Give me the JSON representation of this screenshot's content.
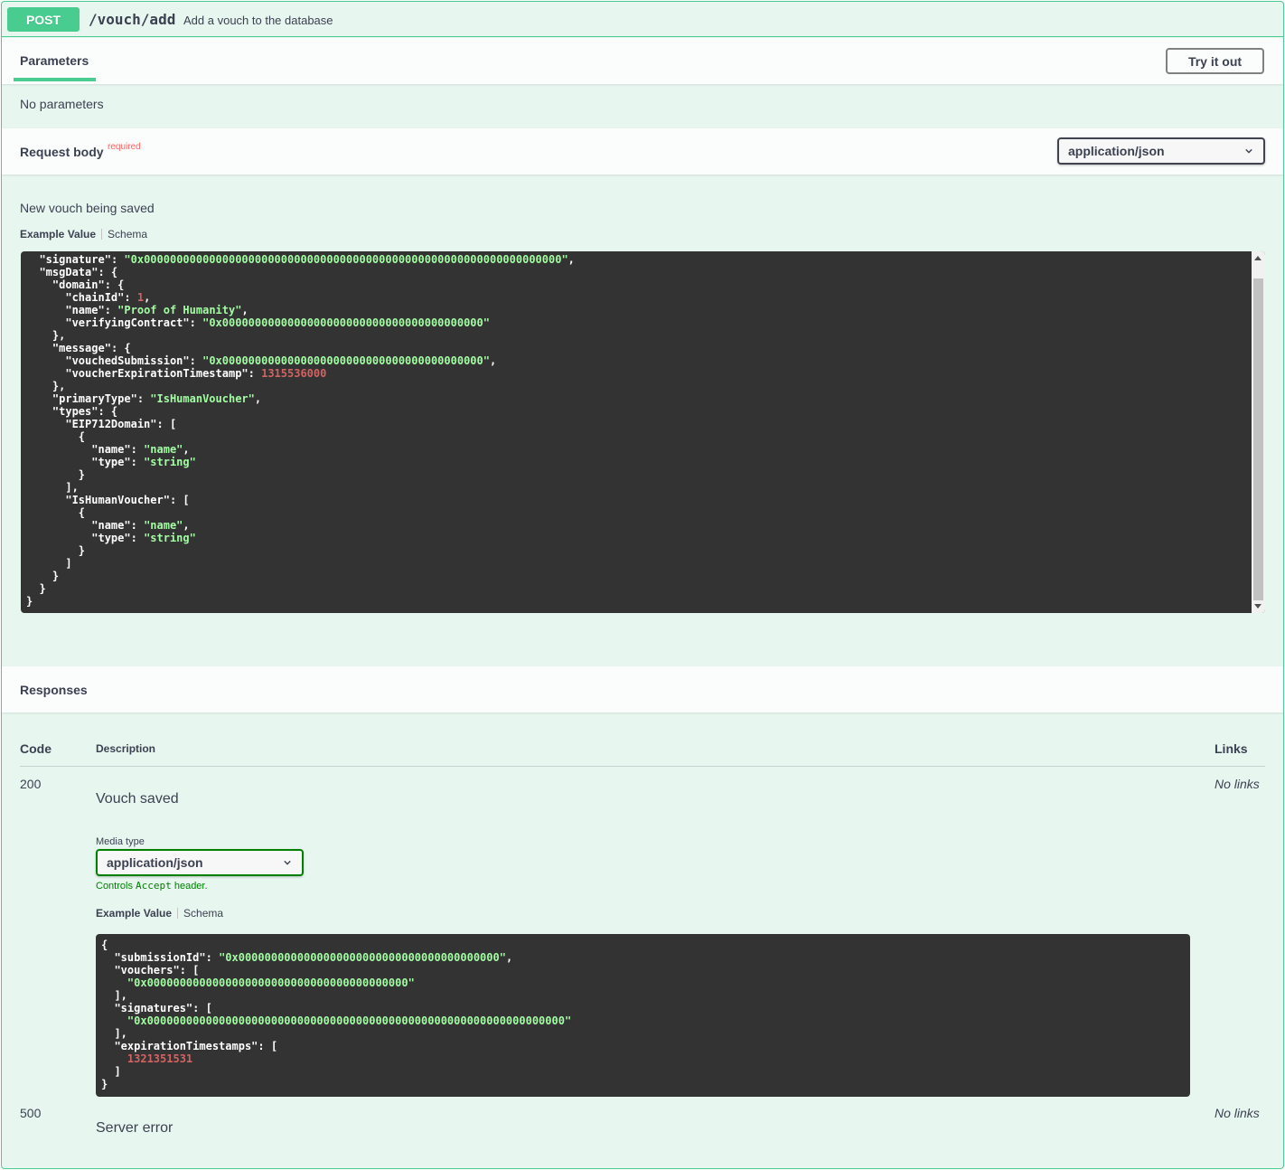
{
  "operation": {
    "method": "POST",
    "path": "/vouch/add",
    "summary": "Add a vouch to the database"
  },
  "parameters": {
    "tab_label": "Parameters",
    "try_it_out": "Try it out",
    "none_text": "No parameters"
  },
  "request_body": {
    "title": "Request body",
    "required": "required",
    "content_type": "application/json",
    "description": "New vouch being saved",
    "example_tab": "Example Value",
    "schema_tab": "Schema",
    "example_lines": [
      [
        [
          "p",
          "  "
        ],
        [
          "k",
          "\"signature\""
        ],
        [
          "p",
          ": "
        ],
        [
          "s",
          "\"0x0000000000000000000000000000000000000000000000000000000000000000\""
        ],
        [
          "p",
          ","
        ]
      ],
      [
        [
          "p",
          "  "
        ],
        [
          "k",
          "\"msgData\""
        ],
        [
          "p",
          ": {"
        ]
      ],
      [
        [
          "p",
          "    "
        ],
        [
          "k",
          "\"domain\""
        ],
        [
          "p",
          ": {"
        ]
      ],
      [
        [
          "p",
          "      "
        ],
        [
          "k",
          "\"chainId\""
        ],
        [
          "p",
          ": "
        ],
        [
          "n",
          "1"
        ],
        [
          "p",
          ","
        ]
      ],
      [
        [
          "p",
          "      "
        ],
        [
          "k",
          "\"name\""
        ],
        [
          "p",
          ": "
        ],
        [
          "s",
          "\"Proof of Humanity\""
        ],
        [
          "p",
          ","
        ]
      ],
      [
        [
          "p",
          "      "
        ],
        [
          "k",
          "\"verifyingContract\""
        ],
        [
          "p",
          ": "
        ],
        [
          "s",
          "\"0x0000000000000000000000000000000000000000\""
        ]
      ],
      [
        [
          "p",
          "    },"
        ]
      ],
      [
        [
          "p",
          "    "
        ],
        [
          "k",
          "\"message\""
        ],
        [
          "p",
          ": {"
        ]
      ],
      [
        [
          "p",
          "      "
        ],
        [
          "k",
          "\"vouchedSubmission\""
        ],
        [
          "p",
          ": "
        ],
        [
          "s",
          "\"0x0000000000000000000000000000000000000000\""
        ],
        [
          "p",
          ","
        ]
      ],
      [
        [
          "p",
          "      "
        ],
        [
          "k",
          "\"voucherExpirationTimestamp\""
        ],
        [
          "p",
          ": "
        ],
        [
          "n",
          "1315536000"
        ]
      ],
      [
        [
          "p",
          "    },"
        ]
      ],
      [
        [
          "p",
          "    "
        ],
        [
          "k",
          "\"primaryType\""
        ],
        [
          "p",
          ": "
        ],
        [
          "s",
          "\"IsHumanVoucher\""
        ],
        [
          "p",
          ","
        ]
      ],
      [
        [
          "p",
          "    "
        ],
        [
          "k",
          "\"types\""
        ],
        [
          "p",
          ": {"
        ]
      ],
      [
        [
          "p",
          "      "
        ],
        [
          "k",
          "\"EIP712Domain\""
        ],
        [
          "p",
          ": ["
        ]
      ],
      [
        [
          "p",
          "        {"
        ]
      ],
      [
        [
          "p",
          "          "
        ],
        [
          "k",
          "\"name\""
        ],
        [
          "p",
          ": "
        ],
        [
          "s",
          "\"name\""
        ],
        [
          "p",
          ","
        ]
      ],
      [
        [
          "p",
          "          "
        ],
        [
          "k",
          "\"type\""
        ],
        [
          "p",
          ": "
        ],
        [
          "s",
          "\"string\""
        ]
      ],
      [
        [
          "p",
          "        }"
        ]
      ],
      [
        [
          "p",
          "      ],"
        ]
      ],
      [
        [
          "p",
          "      "
        ],
        [
          "k",
          "\"IsHumanVoucher\""
        ],
        [
          "p",
          ": ["
        ]
      ],
      [
        [
          "p",
          "        {"
        ]
      ],
      [
        [
          "p",
          "          "
        ],
        [
          "k",
          "\"name\""
        ],
        [
          "p",
          ": "
        ],
        [
          "s",
          "\"name\""
        ],
        [
          "p",
          ","
        ]
      ],
      [
        [
          "p",
          "          "
        ],
        [
          "k",
          "\"type\""
        ],
        [
          "p",
          ": "
        ],
        [
          "s",
          "\"string\""
        ]
      ],
      [
        [
          "p",
          "        }"
        ]
      ],
      [
        [
          "p",
          "      ]"
        ]
      ],
      [
        [
          "p",
          "    }"
        ]
      ],
      [
        [
          "p",
          "  }"
        ]
      ],
      [
        [
          "p",
          "}"
        ]
      ]
    ]
  },
  "responses": {
    "title": "Responses",
    "col_code": "Code",
    "col_description": "Description",
    "col_links": "Links",
    "items": [
      {
        "code": "200",
        "description": "Vouch saved",
        "links": "No links",
        "media_type_label": "Media type",
        "media_type": "application/json",
        "controls_prefix": "Controls ",
        "controls_mono": "Accept",
        "controls_suffix": " header.",
        "example_tab": "Example Value",
        "schema_tab": "Schema",
        "example_lines": [
          [
            [
              "p",
              "{"
            ]
          ],
          [
            [
              "p",
              "  "
            ],
            [
              "k",
              "\"submissionId\""
            ],
            [
              "p",
              ": "
            ],
            [
              "s",
              "\"0x0000000000000000000000000000000000000000\""
            ],
            [
              "p",
              ","
            ]
          ],
          [
            [
              "p",
              "  "
            ],
            [
              "k",
              "\"vouchers\""
            ],
            [
              "p",
              ": ["
            ]
          ],
          [
            [
              "p",
              "    "
            ],
            [
              "s",
              "\"0x0000000000000000000000000000000000000000\""
            ]
          ],
          [
            [
              "p",
              "  ],"
            ]
          ],
          [
            [
              "p",
              "  "
            ],
            [
              "k",
              "\"signatures\""
            ],
            [
              "p",
              ": ["
            ]
          ],
          [
            [
              "p",
              "    "
            ],
            [
              "s",
              "\"0x0000000000000000000000000000000000000000000000000000000000000000\""
            ]
          ],
          [
            [
              "p",
              "  ],"
            ]
          ],
          [
            [
              "p",
              "  "
            ],
            [
              "k",
              "\"expirationTimestamps\""
            ],
            [
              "p",
              ": ["
            ]
          ],
          [
            [
              "p",
              "    "
            ],
            [
              "n",
              "1321351531"
            ]
          ],
          [
            [
              "p",
              "  ]"
            ]
          ],
          [
            [
              "p",
              "}"
            ]
          ]
        ]
      },
      {
        "code": "500",
        "description": "Server error",
        "links": "No links"
      }
    ]
  }
}
